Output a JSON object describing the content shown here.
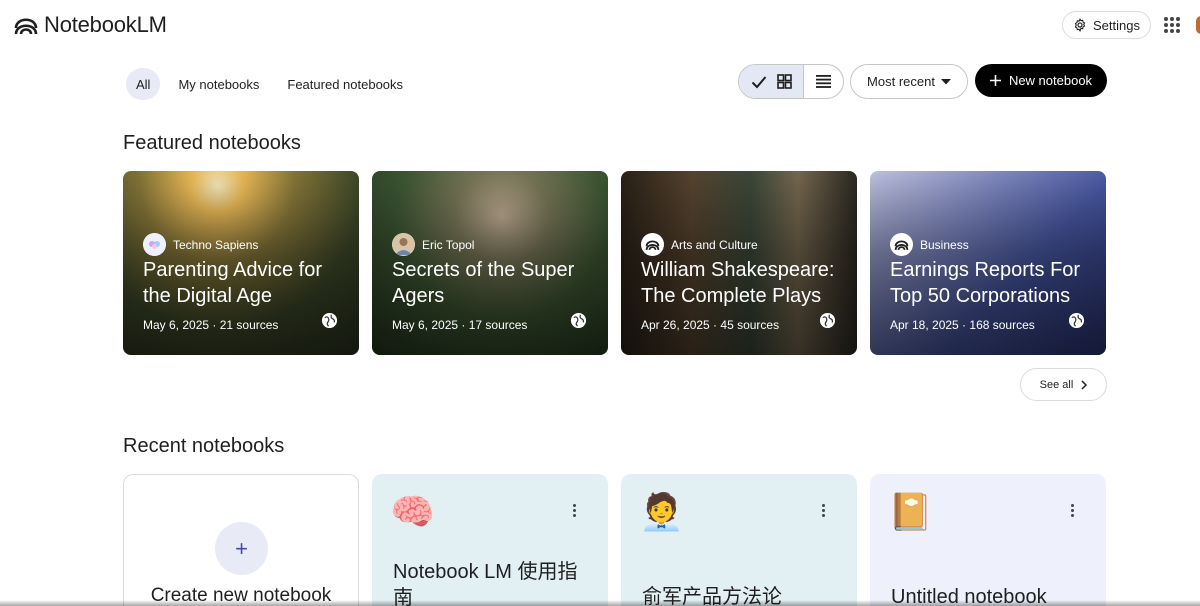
{
  "header": {
    "app_title": "NotebookLM",
    "settings_label": "Settings"
  },
  "filters": {
    "items": [
      {
        "label": "All",
        "active": true
      },
      {
        "label": "My notebooks",
        "active": false
      },
      {
        "label": "Featured notebooks",
        "active": false
      }
    ]
  },
  "toolbar": {
    "view_mode": "grid",
    "sort_label": "Most recent",
    "new_notebook_label": "New notebook"
  },
  "featured": {
    "heading": "Featured notebooks",
    "see_all_label": "See all",
    "cards": [
      {
        "source": "Techno Sapiens",
        "title": "Parenting Advice for the Digital Age",
        "date": "May 6, 2025",
        "sources": "21 sources"
      },
      {
        "source": "Eric Topol",
        "title": "Secrets of the Super Agers",
        "date": "May 6, 2025",
        "sources": "17 sources"
      },
      {
        "source": "Arts and Culture",
        "title": "William Shakespeare: The Complete Plays",
        "date": "Apr 26, 2025",
        "sources": "45 sources"
      },
      {
        "source": "Business",
        "title": "Earnings Reports For Top 50 Corporations",
        "date": "Apr 18, 2025",
        "sources": "168 sources"
      }
    ]
  },
  "recent": {
    "heading": "Recent notebooks",
    "create_label": "Create new notebook",
    "cards": [
      {
        "emoji": "🧠",
        "title": "Notebook LM 使用指南"
      },
      {
        "emoji": "🧑‍💼",
        "title": "俞军产品方法论"
      },
      {
        "emoji": "📔",
        "title": "Untitled notebook"
      }
    ]
  },
  "colors": {
    "accent_chip": "#e8eaf6",
    "primary_button": "#000000",
    "recent_card_blue": "#e2f0f4",
    "recent_card_lavender": "#eef0fb"
  }
}
